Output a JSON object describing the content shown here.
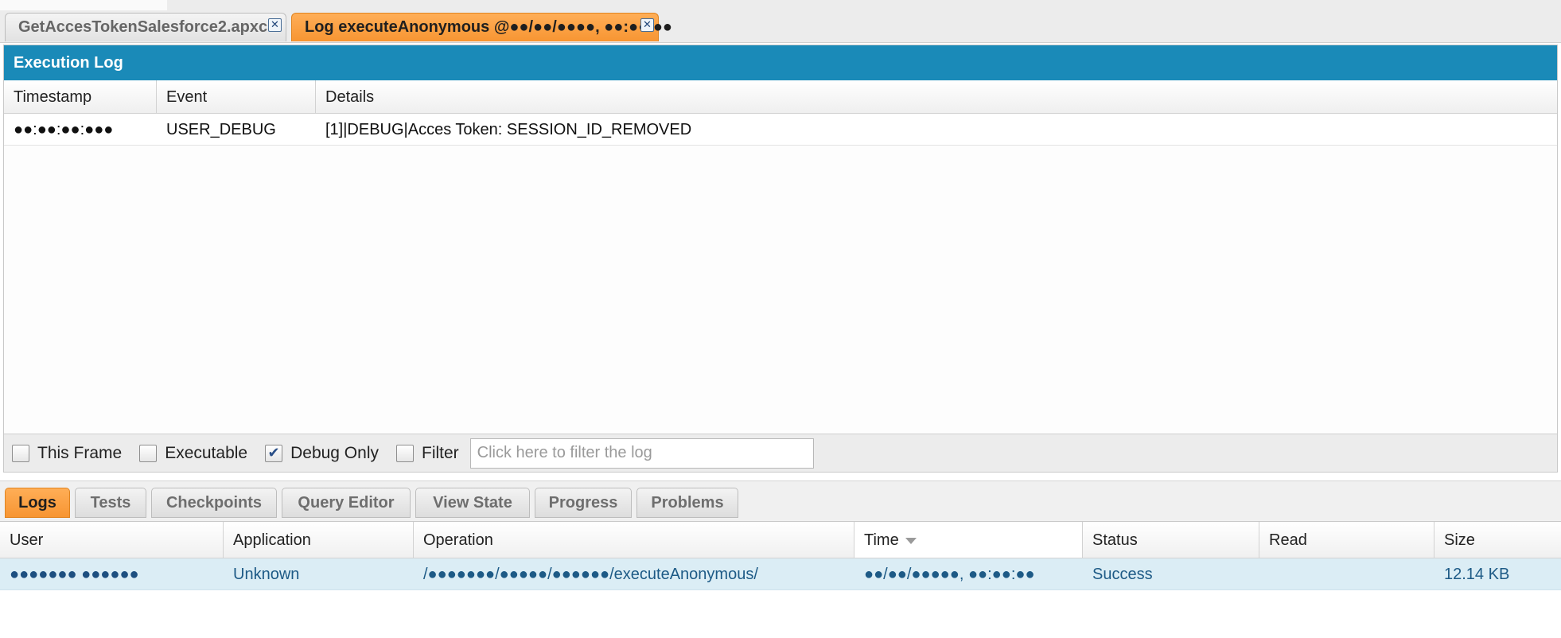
{
  "editor_tabs": [
    {
      "label": "GetAccesTokenSalesforce2.apxc",
      "active": false
    },
    {
      "label": "Log executeAnonymous @●●/●●/●●●●, ●●:●●:●●",
      "active": true
    }
  ],
  "close_glyph": "✕",
  "execution_log": {
    "title": "Execution Log",
    "columns": [
      "Timestamp",
      "Event",
      "Details"
    ],
    "rows": [
      {
        "timestamp": "●●:●●:●●:●●●",
        "event": "USER_DEBUG",
        "details": "[1]|DEBUG|Acces Token: SESSION_ID_REMOVED"
      }
    ]
  },
  "filters": {
    "this_frame": {
      "label": "This Frame",
      "checked": false
    },
    "executable": {
      "label": "Executable",
      "checked": false
    },
    "debug_only": {
      "label": "Debug Only",
      "checked": true
    },
    "filter": {
      "label": "Filter",
      "checked": false
    },
    "filter_placeholder": "Click here to filter the log",
    "check_glyph": "✔"
  },
  "bottom_tabs": [
    {
      "label": "Logs",
      "active": true
    },
    {
      "label": "Tests",
      "active": false
    },
    {
      "label": "Checkpoints",
      "active": false
    },
    {
      "label": "Query Editor",
      "active": false
    },
    {
      "label": "View State",
      "active": false
    },
    {
      "label": "Progress",
      "active": false
    },
    {
      "label": "Problems",
      "active": false
    }
  ],
  "logs": {
    "columns": [
      "User",
      "Application",
      "Operation",
      "Time",
      "Status",
      "Read",
      "Size"
    ],
    "sorted_column": "Time",
    "rows": [
      {
        "user": "●●●●●●● ●●●●●●",
        "application": "Unknown",
        "operation": "/●●●●●●●/●●●●●/●●●●●●/executeAnonymous/",
        "time": "●●/●●/●●●●●, ●●:●●:●●",
        "status": "Success",
        "read": "",
        "size": "12.14 KB"
      }
    ]
  },
  "colors": {
    "accent_orange": "#f79532",
    "header_blue": "#1a8ab8",
    "selected_row": "#dbedf5"
  }
}
